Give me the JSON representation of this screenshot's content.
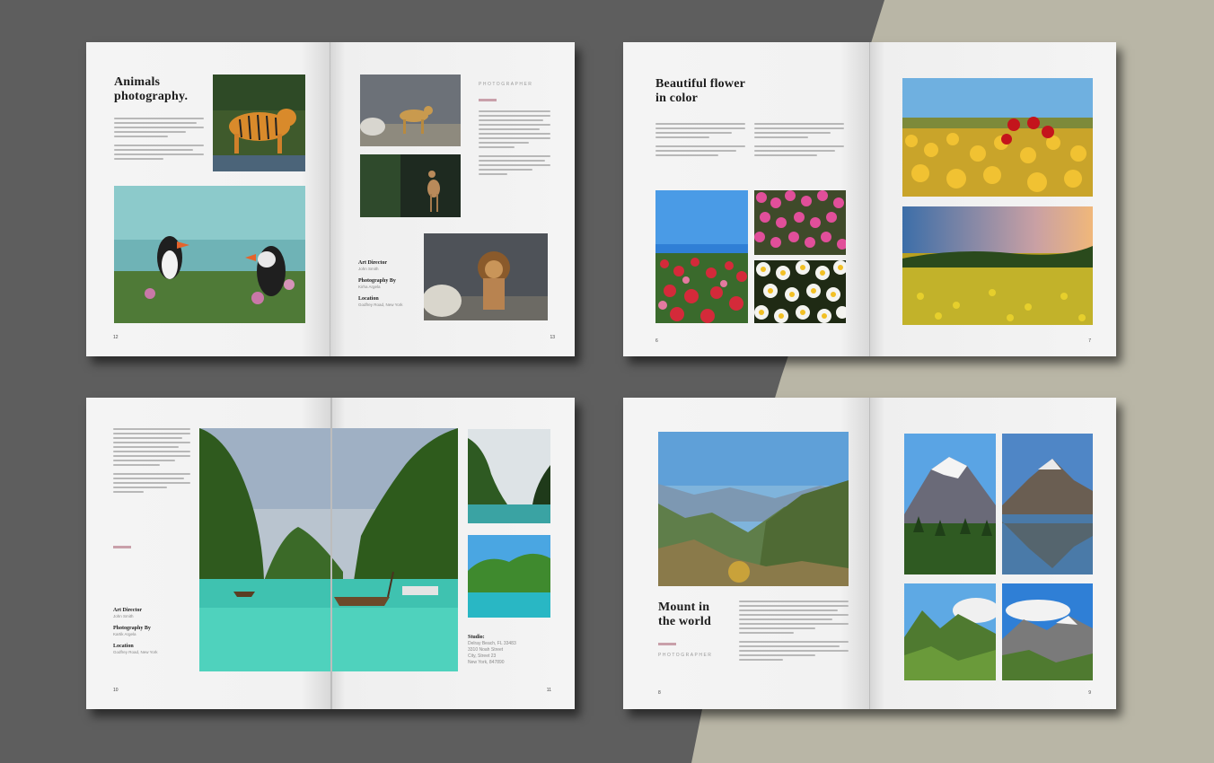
{
  "spreads": {
    "animals": {
      "title_line1": "Animals",
      "title_line2": "photography.",
      "section_label": "PHOTOGRAPHER",
      "art_director_label": "Art Director",
      "art_director_value": "John Smith",
      "photography_label": "Photography By",
      "photography_value": "Kirha Argela",
      "location_label": "Location",
      "location_value": "Godfrey Road, New York",
      "page_left": "12",
      "page_right": "13"
    },
    "flowers": {
      "title_line1": "Beautiful flower",
      "title_line2": "in color",
      "page_left": "6",
      "page_right": "7"
    },
    "islands": {
      "art_director_label": "Art Director",
      "art_director_value": "John Smith",
      "photography_label": "Photography By",
      "photography_value": "Kartik Argela",
      "location_label": "Location",
      "location_value": "Godfrey Road, New York",
      "studio_label": "Studio:",
      "studio_line1": "Delray Beach, FL 33483",
      "studio_line2": "3310 Noah Street",
      "studio_line3": "City, Street 23",
      "studio_line4": "New York, 847890",
      "page_left": "10",
      "page_right": "11"
    },
    "mountains": {
      "title_line1": "Mount in",
      "title_line2": "the world",
      "section_label": "PHOTOGRAPHER",
      "page_left": "8",
      "page_right": "9"
    }
  },
  "colors": {
    "background_dark": "#5e5e5e",
    "background_beige": "#b9b6a6",
    "accent": "#c9a0aa"
  }
}
